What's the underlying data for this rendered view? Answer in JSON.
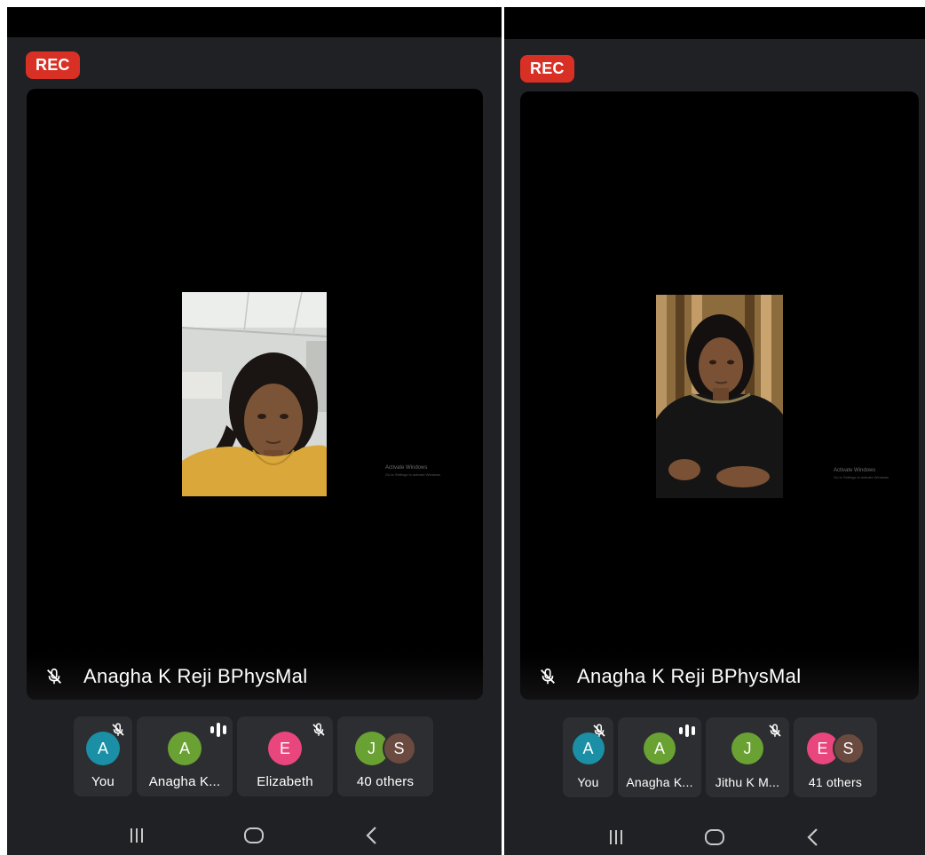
{
  "screens": [
    {
      "rec_label": "REC",
      "speaker": {
        "name": "Anagha K Reji BPhysMal",
        "mic_icon": "mic-off-icon"
      },
      "watermark": {
        "title": "Activate Windows",
        "subtitle": "Go to Settings to activate Windows"
      },
      "participants": [
        {
          "initial": "A",
          "label": "You",
          "color": "#1a8fa5",
          "status_icon": "mic-off-icon"
        },
        {
          "initial": "A",
          "label": "Anagha K...",
          "color": "#6aa133",
          "status_icon": "speaking-icon"
        },
        {
          "initial": "E",
          "label": "Elizabeth",
          "color": "#e8467c",
          "status_icon": "mic-off-icon"
        },
        {
          "initials": [
            "J",
            "S"
          ],
          "label": "40 others",
          "colors": [
            "#6aa133",
            "#6b4a3f"
          ]
        }
      ],
      "nav": [
        "recents-icon",
        "home-icon",
        "back-icon"
      ]
    },
    {
      "rec_label": "REC",
      "speaker": {
        "name": "Anagha K Reji BPhysMal",
        "mic_icon": "mic-off-icon"
      },
      "watermark": {
        "title": "Activate Windows",
        "subtitle": "Go to Settings to activate Windows"
      },
      "participants": [
        {
          "initial": "A",
          "label": "You",
          "color": "#1a8fa5",
          "status_icon": "mic-off-icon"
        },
        {
          "initial": "A",
          "label": "Anagha K...",
          "color": "#6aa133",
          "status_icon": "speaking-icon"
        },
        {
          "initial": "J",
          "label": "Jithu K M...",
          "color": "#6aa133",
          "status_icon": "mic-off-icon"
        },
        {
          "initials": [
            "E",
            "S"
          ],
          "label": "41 others",
          "colors": [
            "#e8467c",
            "#6b4a3f"
          ]
        }
      ],
      "nav": [
        "recents-icon",
        "home-icon",
        "back-icon"
      ]
    }
  ],
  "colors": {
    "rec": "#d93025",
    "background": "#202124",
    "tile": "#2d2e31"
  }
}
